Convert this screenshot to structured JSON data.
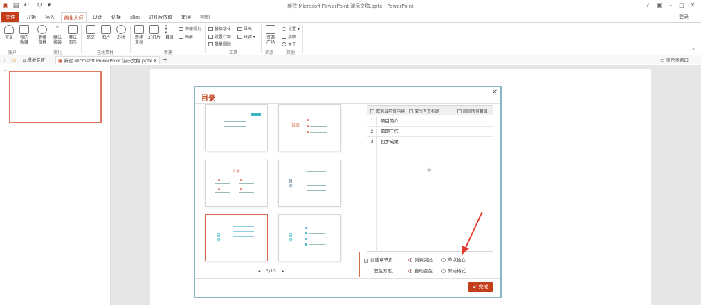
{
  "window": {
    "title": "新建 Microsoft PowerPoint 演示文稿.pptx - PowerPoint",
    "controls": [
      "?",
      "▣",
      "–",
      "□",
      "✕"
    ]
  },
  "tabs": {
    "file": "文件",
    "items": [
      "开始",
      "插入",
      "美化大师",
      "设计",
      "切换",
      "动画",
      "幻灯片放映",
      "审阅",
      "视图"
    ],
    "login": "登录"
  },
  "ribbon": {
    "account": {
      "login": "登录",
      "fav1": "我的",
      "fav2": "收藏",
      "group": "账户"
    },
    "beautify": {
      "b1a": "更换",
      "b1b": "背景",
      "b2a": "魔法",
      "b2b": "换装",
      "b3a": "魔法",
      "b3b": "图示",
      "group": "美化"
    },
    "online": {
      "i1": "范文",
      "i2": "图片",
      "i3": "形状",
      "group": "在线素材"
    },
    "newgrp": {
      "n1a": "新建",
      "n1b": "文档",
      "n2": "幻灯片",
      "n3": "目录",
      "s1": "内容规划",
      "s2": "画册",
      "group": "新建"
    },
    "tools": {
      "t1": "替换字体",
      "t2": "导出",
      "t3": "设置行距",
      "t4": "只读",
      "t5": "批量删除",
      "group": "工具"
    },
    "resources": {
      "r1a": "资源",
      "r1b": "广场",
      "group": "资源"
    },
    "other": {
      "o1": "设置",
      "o2": "求助",
      "o3": "关于",
      "group": "其他"
    }
  },
  "doctabs": {
    "templates": "模板专区",
    "doc": "新建 Microsoft PowerPoint 演示文稿.pptx",
    "right": "显示多窗口"
  },
  "thumbs": {
    "slide_number": "1"
  },
  "dialog": {
    "title": "目录",
    "close": "✕",
    "templates": [
      {
        "label": "目录"
      },
      {
        "label": "目录"
      },
      {
        "label": "目录"
      },
      {
        "label": "目录"
      },
      {
        "label": "目录"
      },
      {
        "label": "目录"
      }
    ],
    "pager": {
      "prev": "◂",
      "page": "3/13",
      "next": "▸"
    },
    "toc_toolbar": {
      "cancel_current": "取消当前页内容",
      "all_titles": "取所有页标题",
      "delete_all": "删除所有目录"
    },
    "toc_items": [
      {
        "num": "1",
        "text": "项目简介"
      },
      {
        "num": "2",
        "text": "前期工作"
      },
      {
        "num": "3",
        "text": "初步成果"
      }
    ],
    "toc_add": "+",
    "options": {
      "create_section_label": "创建章节页：",
      "opt_list": "列表突出",
      "opt_single": "单点独立",
      "color_label": "配色方案：",
      "opt_auto": "自动变色",
      "opt_original": "原始格式"
    },
    "done": "完成"
  },
  "colors": {
    "accent": "#c43e1c",
    "highlight_box": "#d96b4c",
    "dialog_border": "#8ab6c8"
  }
}
